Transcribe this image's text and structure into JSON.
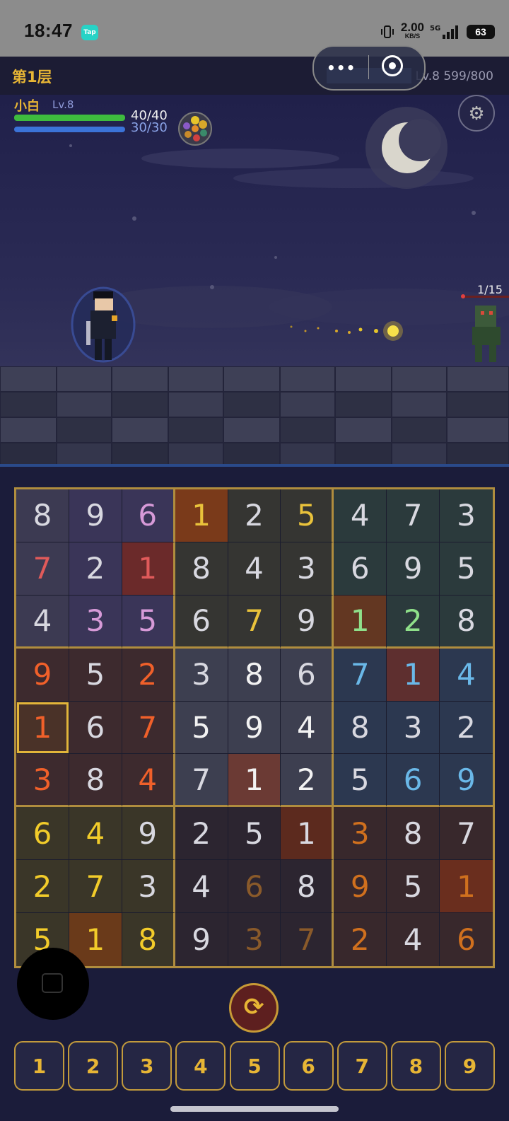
{
  "status": {
    "time": "18:47",
    "app_badge": "Tap",
    "speed": "2.00",
    "speed_unit": "KB/S",
    "battery": "63"
  },
  "header": {
    "floor": "第1层",
    "level_exp": "Lv.8 599/800",
    "xp_fill": 0.749
  },
  "player": {
    "name": "小白",
    "level": "Lv.8",
    "hp": "40/40",
    "mp": "30/30"
  },
  "enemy": {
    "wave": "1/15"
  },
  "board": [
    [
      {
        "v": "8",
        "c": "#d8d8e0",
        "bg": "#3c3a52"
      },
      {
        "v": "9",
        "c": "#d8d8e0",
        "bg": "#3a3558"
      },
      {
        "v": "6",
        "c": "#d79ad8",
        "bg": "#3a3558"
      },
      {
        "v": "1",
        "c": "#e9c23b",
        "bg": "#7a3a1a"
      },
      {
        "v": "2",
        "c": "#d8d8e0",
        "bg": "#353532"
      },
      {
        "v": "5",
        "c": "#e9c23b",
        "bg": "#353532"
      },
      {
        "v": "4",
        "c": "#d8d8e0",
        "bg": "#2b3a3c"
      },
      {
        "v": "7",
        "c": "#d8d8e0",
        "bg": "#2b3a3c"
      },
      {
        "v": "3",
        "c": "#d8d8e0",
        "bg": "#2b3a3c"
      }
    ],
    [
      {
        "v": "7",
        "c": "#e05a5a",
        "bg": "#3c3a52"
      },
      {
        "v": "2",
        "c": "#d8d8e0",
        "bg": "#3a3558"
      },
      {
        "v": "1",
        "c": "#e05a5a",
        "bg": "#6b2a2a"
      },
      {
        "v": "8",
        "c": "#d8d8e0",
        "bg": "#353532"
      },
      {
        "v": "4",
        "c": "#d8d8e0",
        "bg": "#353532"
      },
      {
        "v": "3",
        "c": "#d8d8e0",
        "bg": "#353532"
      },
      {
        "v": "6",
        "c": "#d8d8e0",
        "bg": "#2b3a3c"
      },
      {
        "v": "9",
        "c": "#d8d8e0",
        "bg": "#2b3a3c"
      },
      {
        "v": "5",
        "c": "#d8d8e0",
        "bg": "#2b3a3c"
      }
    ],
    [
      {
        "v": "4",
        "c": "#d8d8e0",
        "bg": "#3c3a52"
      },
      {
        "v": "3",
        "c": "#d79ad8",
        "bg": "#3a3558"
      },
      {
        "v": "5",
        "c": "#d79ad8",
        "bg": "#3a3558"
      },
      {
        "v": "6",
        "c": "#d8d8e0",
        "bg": "#353532"
      },
      {
        "v": "7",
        "c": "#e9c23b",
        "bg": "#353532"
      },
      {
        "v": "9",
        "c": "#d8d8e0",
        "bg": "#353532"
      },
      {
        "v": "1",
        "c": "#8fe08a",
        "bg": "#633722"
      },
      {
        "v": "2",
        "c": "#8fe08a",
        "bg": "#2b3a3c"
      },
      {
        "v": "8",
        "c": "#d8d8e0",
        "bg": "#2b3a3c"
      }
    ],
    [
      {
        "v": "9",
        "c": "#f0602a",
        "bg": "#3d2a2e"
      },
      {
        "v": "5",
        "c": "#d8d8e0",
        "bg": "#3d2a2e"
      },
      {
        "v": "2",
        "c": "#f0602a",
        "bg": "#3d2a2e"
      },
      {
        "v": "3",
        "c": "#d8d8e0",
        "bg": "#3d3f50"
      },
      {
        "v": "8",
        "c": "#f2f2f2",
        "bg": "#3d3f50"
      },
      {
        "v": "6",
        "c": "#d8d8e0",
        "bg": "#3d3f50"
      },
      {
        "v": "7",
        "c": "#6ab8e8",
        "bg": "#2c3850"
      },
      {
        "v": "1",
        "c": "#6ab8e8",
        "bg": "#5e2f2f"
      },
      {
        "v": "4",
        "c": "#6ab8e8",
        "bg": "#2c3850"
      }
    ],
    [
      {
        "v": "1",
        "c": "#f0602a",
        "bg": "#4a3228",
        "sel": true
      },
      {
        "v": "6",
        "c": "#d8d8e0",
        "bg": "#3d2a2e"
      },
      {
        "v": "7",
        "c": "#f0602a",
        "bg": "#3d2a2e"
      },
      {
        "v": "5",
        "c": "#f2f2f2",
        "bg": "#3d3f50"
      },
      {
        "v": "9",
        "c": "#f2f2f2",
        "bg": "#3d3f50"
      },
      {
        "v": "4",
        "c": "#f2f2f2",
        "bg": "#3d3f50"
      },
      {
        "v": "8",
        "c": "#d8d8e0",
        "bg": "#2c3850"
      },
      {
        "v": "3",
        "c": "#d8d8e0",
        "bg": "#2c3850"
      },
      {
        "v": "2",
        "c": "#d8d8e0",
        "bg": "#2c3850"
      }
    ],
    [
      {
        "v": "3",
        "c": "#f0602a",
        "bg": "#3d2a2e"
      },
      {
        "v": "8",
        "c": "#d8d8e0",
        "bg": "#3d2a2e"
      },
      {
        "v": "4",
        "c": "#f0602a",
        "bg": "#3d2a2e"
      },
      {
        "v": "7",
        "c": "#d8d8e0",
        "bg": "#3d3f50"
      },
      {
        "v": "1",
        "c": "#f2f2f2",
        "bg": "#6b3a34"
      },
      {
        "v": "2",
        "c": "#f2f2f2",
        "bg": "#3d3f50"
      },
      {
        "v": "5",
        "c": "#d8d8e0",
        "bg": "#2c3850"
      },
      {
        "v": "6",
        "c": "#6ab8e8",
        "bg": "#2c3850"
      },
      {
        "v": "9",
        "c": "#6ab8e8",
        "bg": "#2c3850"
      }
    ],
    [
      {
        "v": "6",
        "c": "#f2cc2a",
        "bg": "#3a3628"
      },
      {
        "v": "4",
        "c": "#f2cc2a",
        "bg": "#3a3628"
      },
      {
        "v": "9",
        "c": "#d8d8e0",
        "bg": "#3a3628"
      },
      {
        "v": "2",
        "c": "#d8d8e0",
        "bg": "#2c2530"
      },
      {
        "v": "5",
        "c": "#d8d8e0",
        "bg": "#2c2530"
      },
      {
        "v": "1",
        "c": "#d8d8e0",
        "bg": "#5c2a1e"
      },
      {
        "v": "3",
        "c": "#d0701e",
        "bg": "#38282c"
      },
      {
        "v": "8",
        "c": "#d8d8e0",
        "bg": "#38282c"
      },
      {
        "v": "7",
        "c": "#d8d8e0",
        "bg": "#38282c"
      }
    ],
    [
      {
        "v": "2",
        "c": "#f2cc2a",
        "bg": "#3a3628"
      },
      {
        "v": "7",
        "c": "#f2cc2a",
        "bg": "#3a3628"
      },
      {
        "v": "3",
        "c": "#d8d8e0",
        "bg": "#3a3628"
      },
      {
        "v": "4",
        "c": "#d8d8e0",
        "bg": "#2c2530"
      },
      {
        "v": "6",
        "c": "#8a5a2a",
        "bg": "#2c2530"
      },
      {
        "v": "8",
        "c": "#d8d8e0",
        "bg": "#2c2530"
      },
      {
        "v": "9",
        "c": "#d0701e",
        "bg": "#38282c"
      },
      {
        "v": "5",
        "c": "#d8d8e0",
        "bg": "#38282c"
      },
      {
        "v": "1",
        "c": "#d0701e",
        "bg": "#6a2e1e"
      }
    ],
    [
      {
        "v": "5",
        "c": "#f2cc2a",
        "bg": "#3a3628"
      },
      {
        "v": "1",
        "c": "#f2cc2a",
        "bg": "#6a3a1a"
      },
      {
        "v": "8",
        "c": "#f2cc2a",
        "bg": "#3a3628"
      },
      {
        "v": "9",
        "c": "#d8d8e0",
        "bg": "#2c2530"
      },
      {
        "v": "3",
        "c": "#8a5a2a",
        "bg": "#2c2530"
      },
      {
        "v": "7",
        "c": "#8a5a2a",
        "bg": "#2c2530"
      },
      {
        "v": "2",
        "c": "#d0701e",
        "bg": "#38282c"
      },
      {
        "v": "4",
        "c": "#d8d8e0",
        "bg": "#38282c"
      },
      {
        "v": "6",
        "c": "#d0701e",
        "bg": "#38282c"
      }
    ]
  ],
  "numpad": [
    "1",
    "2",
    "3",
    "4",
    "5",
    "6",
    "7",
    "8",
    "9"
  ]
}
